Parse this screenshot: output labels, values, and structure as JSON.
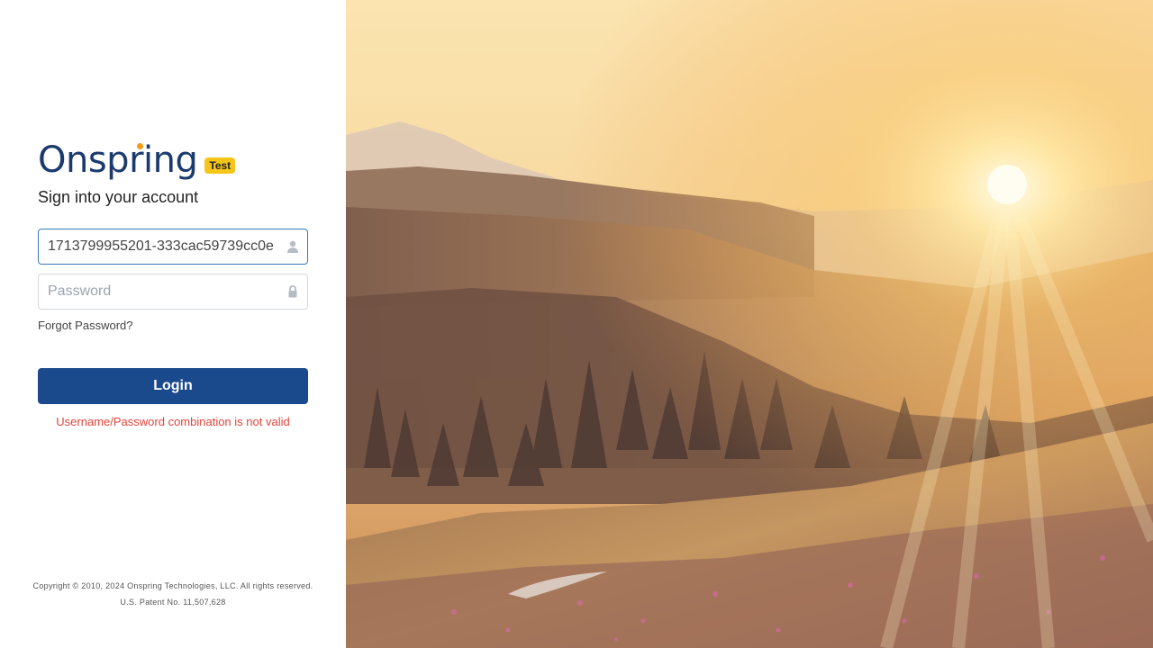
{
  "brand": {
    "logo_text": "Onspring",
    "env_badge": "Test"
  },
  "login": {
    "subtitle": "Sign into your account",
    "username": {
      "value": "1713799955201-333cac59739cc0e",
      "icon": "user-icon"
    },
    "password": {
      "value": "",
      "placeholder": "Password",
      "icon": "lock-icon"
    },
    "forgot_label": "Forgot Password?",
    "login_label": "Login",
    "error": "Username/Password combination is not valid"
  },
  "footer": {
    "copyright": "Copyright © 2010, 2024 Onspring Technologies, LLC. All rights reserved.",
    "patent": "U.S. Patent No. 11,507,628"
  },
  "colors": {
    "primary": "#1b4a8c",
    "logo": "#1b3a6e",
    "badge": "#f5c518",
    "error": "#e0443a",
    "focus_border": "#3a78b7"
  }
}
